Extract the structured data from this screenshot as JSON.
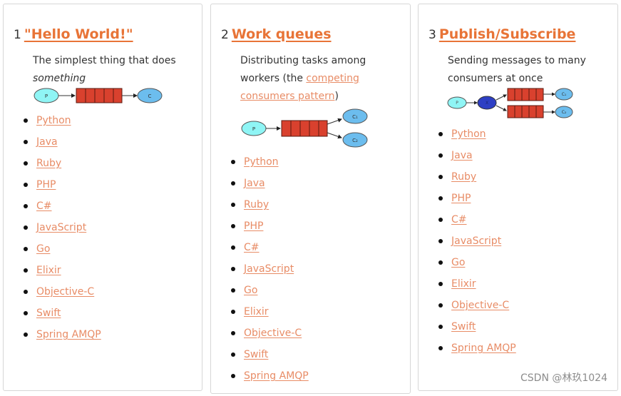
{
  "colors": {
    "accent": "#e87437",
    "link": "#e88c66",
    "queue": "#d9412e",
    "producer": "#8ff5f5",
    "consumer": "#6cbdee",
    "exchange": "#2d3fc4"
  },
  "tutorials": [
    {
      "number": "1",
      "title": "\"Hello World!\"",
      "description_prefix": "The simplest thing that does",
      "description_em": "something",
      "diagram": {
        "producer": "P",
        "consumers": [
          "C"
        ]
      },
      "links": [
        "Python",
        "Java",
        "Ruby",
        "PHP",
        "C#",
        "JavaScript",
        "Go",
        "Elixir",
        "Objective-C",
        "Swift",
        "Spring AMQP"
      ]
    },
    {
      "number": "2",
      "title": "Work queues",
      "description_prefix": "Distributing tasks among workers (the ",
      "description_link": "competing consumers pattern",
      "description_suffix": ")",
      "diagram": {
        "producer": "P",
        "consumers": [
          "C₁",
          "C₂"
        ]
      },
      "links": [
        "Python",
        "Java",
        "Ruby",
        "PHP",
        "C#",
        "JavaScript",
        "Go",
        "Elixir",
        "Objective-C",
        "Swift",
        "Spring AMQP"
      ]
    },
    {
      "number": "3",
      "title": "Publish/Subscribe",
      "description_prefix": "Sending messages to many consumers at once",
      "diagram": {
        "producer": "P",
        "exchange": "X",
        "consumers": [
          "C₁",
          "C₂"
        ]
      },
      "links": [
        "Python",
        "Java",
        "Ruby",
        "PHP",
        "C#",
        "JavaScript",
        "Go",
        "Elixir",
        "Objective-C",
        "Swift",
        "Spring AMQP"
      ]
    }
  ],
  "watermark": "CSDN @林玖1024"
}
